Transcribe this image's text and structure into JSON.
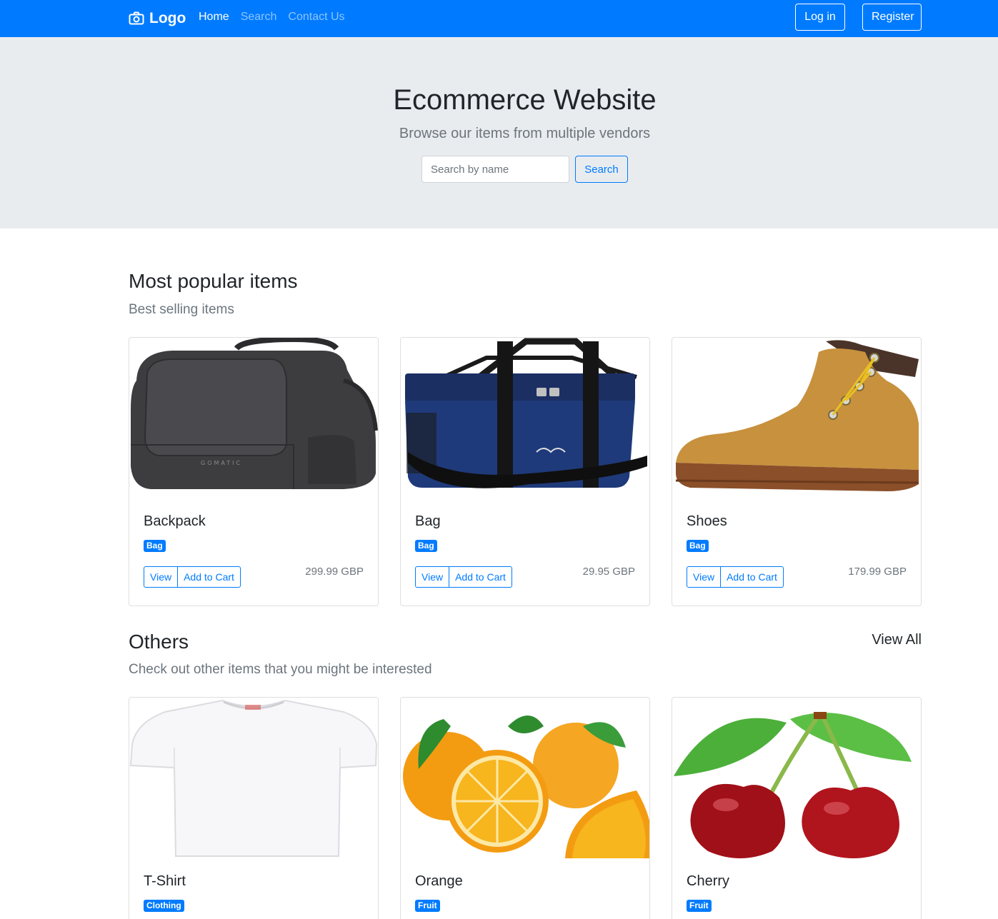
{
  "nav": {
    "brand": "Logo",
    "links": [
      "Home",
      "Search",
      "Contact Us"
    ],
    "login": "Log in",
    "register": "Register"
  },
  "hero": {
    "title": "Ecommerce Website",
    "subtitle": "Browse our items from multiple vendors",
    "search_placeholder": "Search by name",
    "search_button": "Search"
  },
  "popular": {
    "title": "Most popular items",
    "subtitle": "Best selling items",
    "items": [
      {
        "name": "Backpack",
        "badge": "Bag",
        "price": "299.99 GBP",
        "view": "View",
        "add": "Add to Cart",
        "image": "backpack"
      },
      {
        "name": "Bag",
        "badge": "Bag",
        "price": "29.95 GBP",
        "view": "View",
        "add": "Add to Cart",
        "image": "cooler-bag"
      },
      {
        "name": "Shoes",
        "badge": "Bag",
        "price": "179.99 GBP",
        "view": "View",
        "add": "Add to Cart",
        "image": "boot"
      }
    ]
  },
  "others": {
    "title": "Others",
    "subtitle": "Check out other items that you might be interested",
    "view_all": "View All",
    "items": [
      {
        "name": "T-Shirt",
        "badge": "Clothing",
        "image": "tshirt"
      },
      {
        "name": "Orange",
        "badge": "Fruit",
        "image": "orange"
      },
      {
        "name": "Cherry",
        "badge": "Fruit",
        "image": "cherry"
      }
    ]
  },
  "colors": {
    "primary": "#007bff",
    "hero_bg": "#e9ecef",
    "muted": "#6c757d"
  }
}
